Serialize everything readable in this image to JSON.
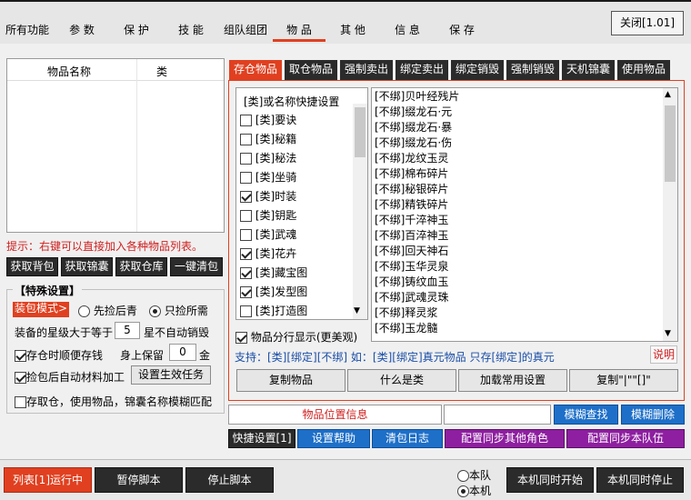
{
  "nav": {
    "tabs": [
      "所有功能",
      "参 数",
      "保 护",
      "技 能",
      "组队组团",
      "物 品",
      "其 他",
      "信 息",
      "保 存"
    ],
    "close_label": "关闭[1.01]"
  },
  "left": {
    "col_name": "物品名称",
    "col_type": "类",
    "hint": "提示：右键可以直接加入各种物品列表。",
    "buttons": [
      "获取背包",
      "获取锦囊",
      "获取仓库",
      "一键清包"
    ],
    "special_title": "【特殊设置】",
    "pick_mode_label": "装包模式>",
    "radio_pick_first": "先捡后青",
    "radio_pick_only": "只捡所需",
    "star_label": "装备的星级大于等于",
    "star_value": "5",
    "star_suffix": "星不自动销毁",
    "store_label": "存仓时顺便存钱",
    "keep_label": "身上保留",
    "keep_value": "0",
    "keep_suffix": "金",
    "auto_process_label": "捡包后自动材料加工",
    "set_task_label": "设置生效任务",
    "fuzzy_label": "存取仓，使用物品，锦囊名称模糊匹配"
  },
  "right": {
    "tabs": [
      "存仓物品",
      "取仓物品",
      "强制卖出",
      "绑定卖出",
      "绑定销毁",
      "强制销毁",
      "天机锦囊",
      "使用物品"
    ],
    "cat_header": "[类]或名称快捷设置",
    "categories": [
      {
        "label": "[类]要诀",
        "checked": false
      },
      {
        "label": "[类]秘籍",
        "checked": false
      },
      {
        "label": "[类]秘法",
        "checked": false
      },
      {
        "label": "[类]坐骑",
        "checked": false
      },
      {
        "label": "[类]时装",
        "checked": true
      },
      {
        "label": "[类]钥匙",
        "checked": false
      },
      {
        "label": "[类]武魂",
        "checked": false
      },
      {
        "label": "[类]花卉",
        "checked": true
      },
      {
        "label": "[类]藏宝图",
        "checked": true
      },
      {
        "label": "[类]发型图",
        "checked": true
      },
      {
        "label": "[类]打造图",
        "checked": false
      }
    ],
    "items": [
      "[不绑]贝叶经残片",
      "[不绑]缀龙石·元",
      "[不绑]缀龙石·暴",
      "[不绑]缀龙石·伤",
      "[不绑]龙纹玉灵",
      "[不绑]棉布碎片",
      "[不绑]秘银碎片",
      "[不绑]精铁碎片",
      "[不绑]千淬神玉",
      "[不绑]百淬神玉",
      "[不绑]回天神石",
      "[不绑]玉华灵泉",
      "[不绑]铸纹血玉",
      "[不绑]武魂灵珠",
      "[不绑]释灵浆",
      "[不绑]玉龙髓"
    ],
    "split_label": "物品分行显示(更美观)",
    "support_text": "支持：[类][绑定][不绑] 如：[类][绑定]真元物品 只存[绑定]的真元",
    "explain_label": "说明",
    "actions": [
      "复制物品",
      "什么是类",
      "加载常用设置",
      "复制\"|\"\"[]\""
    ],
    "location_label": "物品位置信息",
    "fuzzy_search": "模糊查找",
    "fuzzy_delete": "模糊删除",
    "quick_set": "快捷设置[1]",
    "set_help": "设置帮助",
    "clear_log": "清包日志",
    "sync_other": "配置同步其他角色",
    "sync_team": "配置同步本队伍"
  },
  "bottom": {
    "list_running": "列表[1]运行中",
    "pause": "暂停脚本",
    "stop": "停止脚本",
    "radio_team": "本队",
    "radio_local": "本机",
    "start_same": "本机同时开始",
    "stop_same": "本机同时停止"
  }
}
